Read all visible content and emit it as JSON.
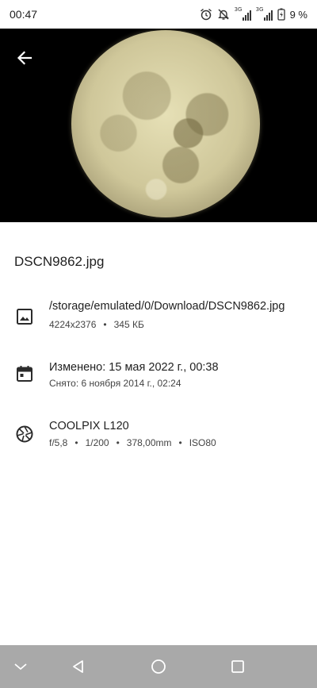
{
  "status_bar": {
    "time": "00:47",
    "network_1": "3G",
    "network_2": "3G",
    "battery": "9 %"
  },
  "photo": {
    "back_icon": "arrow-back-icon"
  },
  "details": {
    "file_name": "DSCN9862.jpg",
    "path_row": {
      "icon": "image-icon",
      "path": "/storage/emulated/0/Download/DSCN9862.jpg",
      "resolution": "4224x2376",
      "size": "345 КБ"
    },
    "date_row": {
      "icon": "calendar-icon",
      "modified": "Изменено: 15 мая 2022 г., 00:38",
      "taken": "Снято: 6 ноября 2014 г., 02:24"
    },
    "camera_row": {
      "icon": "aperture-icon",
      "model": "COOLPIX L120",
      "aperture": "f/5,8",
      "shutter": "1/200",
      "focal": "378,00mm",
      "iso": "ISO80"
    }
  },
  "navbar": {
    "items": [
      "chevron-down-icon",
      "back-triangle-icon",
      "home-circle-icon",
      "recents-square-icon"
    ],
    "background": "#a9a9a9"
  },
  "separator": "•"
}
